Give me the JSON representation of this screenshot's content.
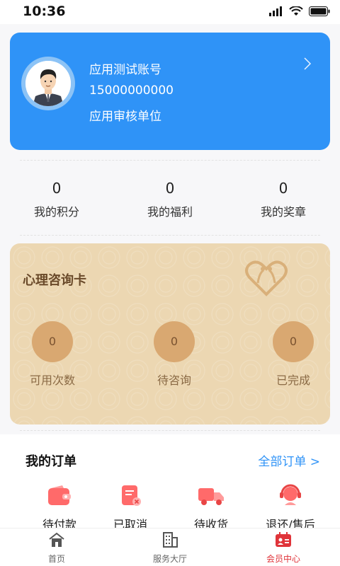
{
  "status_bar": {
    "time": "10:36"
  },
  "profile": {
    "name": "应用测试账号",
    "phone": "15000000000",
    "organization": "应用审核单位"
  },
  "stats": [
    {
      "value": "0",
      "label": "我的积分"
    },
    {
      "value": "0",
      "label": "我的福利"
    },
    {
      "value": "0",
      "label": "我的奖章"
    }
  ],
  "consult_card": {
    "title": "心理咨询卡",
    "items": [
      {
        "value": "0",
        "label": "可用次数"
      },
      {
        "value": "0",
        "label": "待咨询"
      },
      {
        "value": "0",
        "label": "已完成"
      }
    ]
  },
  "orders": {
    "title": "我的订单",
    "all_link": "全部订单 >",
    "items": [
      {
        "label": "待付款",
        "icon": "wallet-icon"
      },
      {
        "label": "已取消",
        "icon": "cancelled-order-icon"
      },
      {
        "label": "待收货",
        "icon": "delivery-truck-icon"
      },
      {
        "label": "退还/售后",
        "icon": "customer-service-icon"
      }
    ]
  },
  "tabbar": {
    "items": [
      {
        "label": "首页",
        "icon": "home-icon"
      },
      {
        "label": "服务大厅",
        "icon": "building-icon"
      },
      {
        "label": "会员中心",
        "icon": "member-card-icon",
        "active": true
      }
    ]
  },
  "colors": {
    "accent": "#2f93f7",
    "active_tab": "#e0343a",
    "card_gold": "#ecd7b2"
  }
}
